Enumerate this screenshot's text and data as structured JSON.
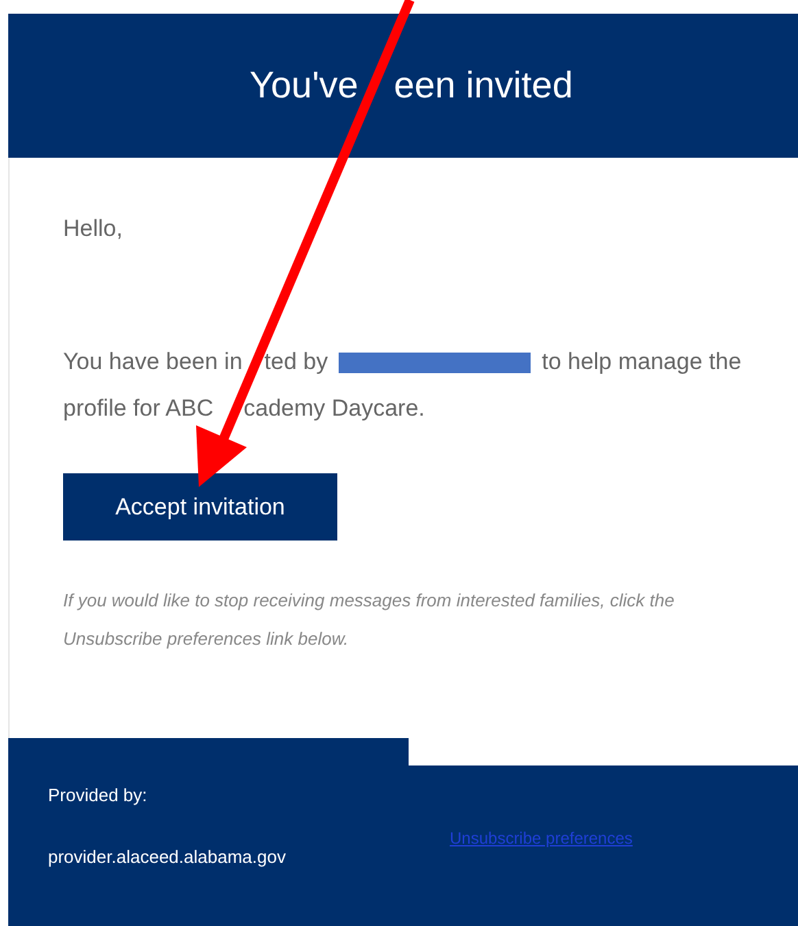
{
  "header": {
    "title_before_arrow": "You've",
    "title_after_arrow": "een invited"
  },
  "body": {
    "greeting": "Hello,",
    "line1_before_arrow": "You have been in",
    "line1_after_arrow": "ted by",
    "line1_after_redaction": "to help manage the",
    "line2_before_arrow": "profile for ABC",
    "line2_after_arrow": "cademy Daycare.",
    "accept_button": "Accept invitation",
    "note": "If you would like to stop receiving messages from interested families, click the Unsubscribe preferences link below."
  },
  "footer": {
    "provided_by_label": "Provided by:",
    "provider_site": "provider.alaceed.alabama.gov",
    "unsubscribe_link": "Unsubscribe preferences"
  }
}
